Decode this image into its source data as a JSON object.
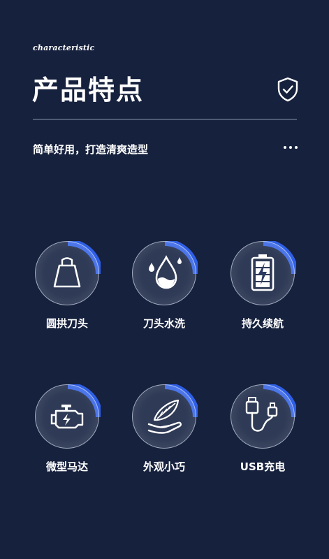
{
  "header": {
    "kicker": "characteristic",
    "title": "产品特点",
    "subtitle": "简单好用，打造清爽造型"
  },
  "features": [
    {
      "label": "圆拱刀头",
      "icon": "dome-blade-icon"
    },
    {
      "label": "刀头水洗",
      "icon": "water-drop-icon"
    },
    {
      "label": "持久续航",
      "icon": "battery-icon"
    },
    {
      "label": "微型马达",
      "icon": "motor-icon"
    },
    {
      "label": "外观小巧",
      "icon": "hand-feather-icon"
    },
    {
      "label": "USB充电",
      "icon": "usb-cable-icon"
    }
  ],
  "colors": {
    "background": "#16213d",
    "accent": "#2f5fe6",
    "text": "#ffffff"
  }
}
